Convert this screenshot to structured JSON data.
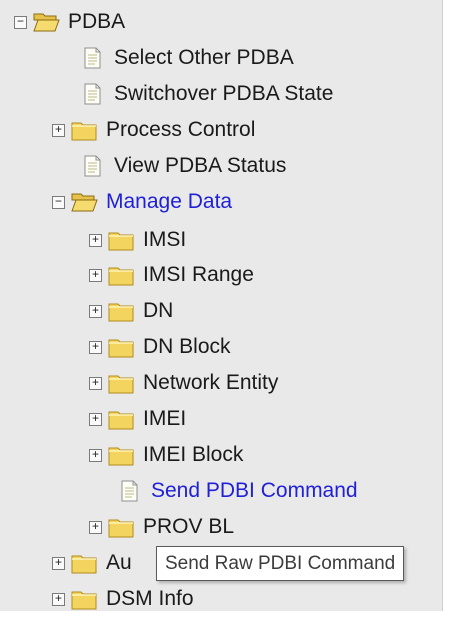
{
  "colors": {
    "link": "#2020d8",
    "text": "#1a1a1a",
    "folder": "#f3d45f",
    "background": "#e9e9e9"
  },
  "icons": {
    "folder_closed": "folder-icon",
    "folder_open": "folder-open-icon",
    "document": "document-icon",
    "expand": "plus",
    "collapse": "minus"
  },
  "tree": {
    "root_label": "PDBA",
    "items": [
      {
        "label": "Select Other PDBA"
      },
      {
        "label": "Switchover PDBA State"
      },
      {
        "label": "Process Control"
      },
      {
        "label": "View PDBA Status"
      },
      {
        "label": "Manage Data"
      },
      {
        "label": "IMSI"
      },
      {
        "label": "IMSI Range"
      },
      {
        "label": "DN"
      },
      {
        "label": "DN Block"
      },
      {
        "label": "Network Entity"
      },
      {
        "label": "IMEI"
      },
      {
        "label": "IMEI Block"
      },
      {
        "label": "Send PDBI Command"
      },
      {
        "label": "PROV BL"
      },
      {
        "label": "Au"
      },
      {
        "label": "DSM Info"
      }
    ],
    "expand_symbol": "+",
    "collapse_symbol": "−"
  },
  "tooltip": {
    "text": "Send Raw PDBI Command"
  }
}
